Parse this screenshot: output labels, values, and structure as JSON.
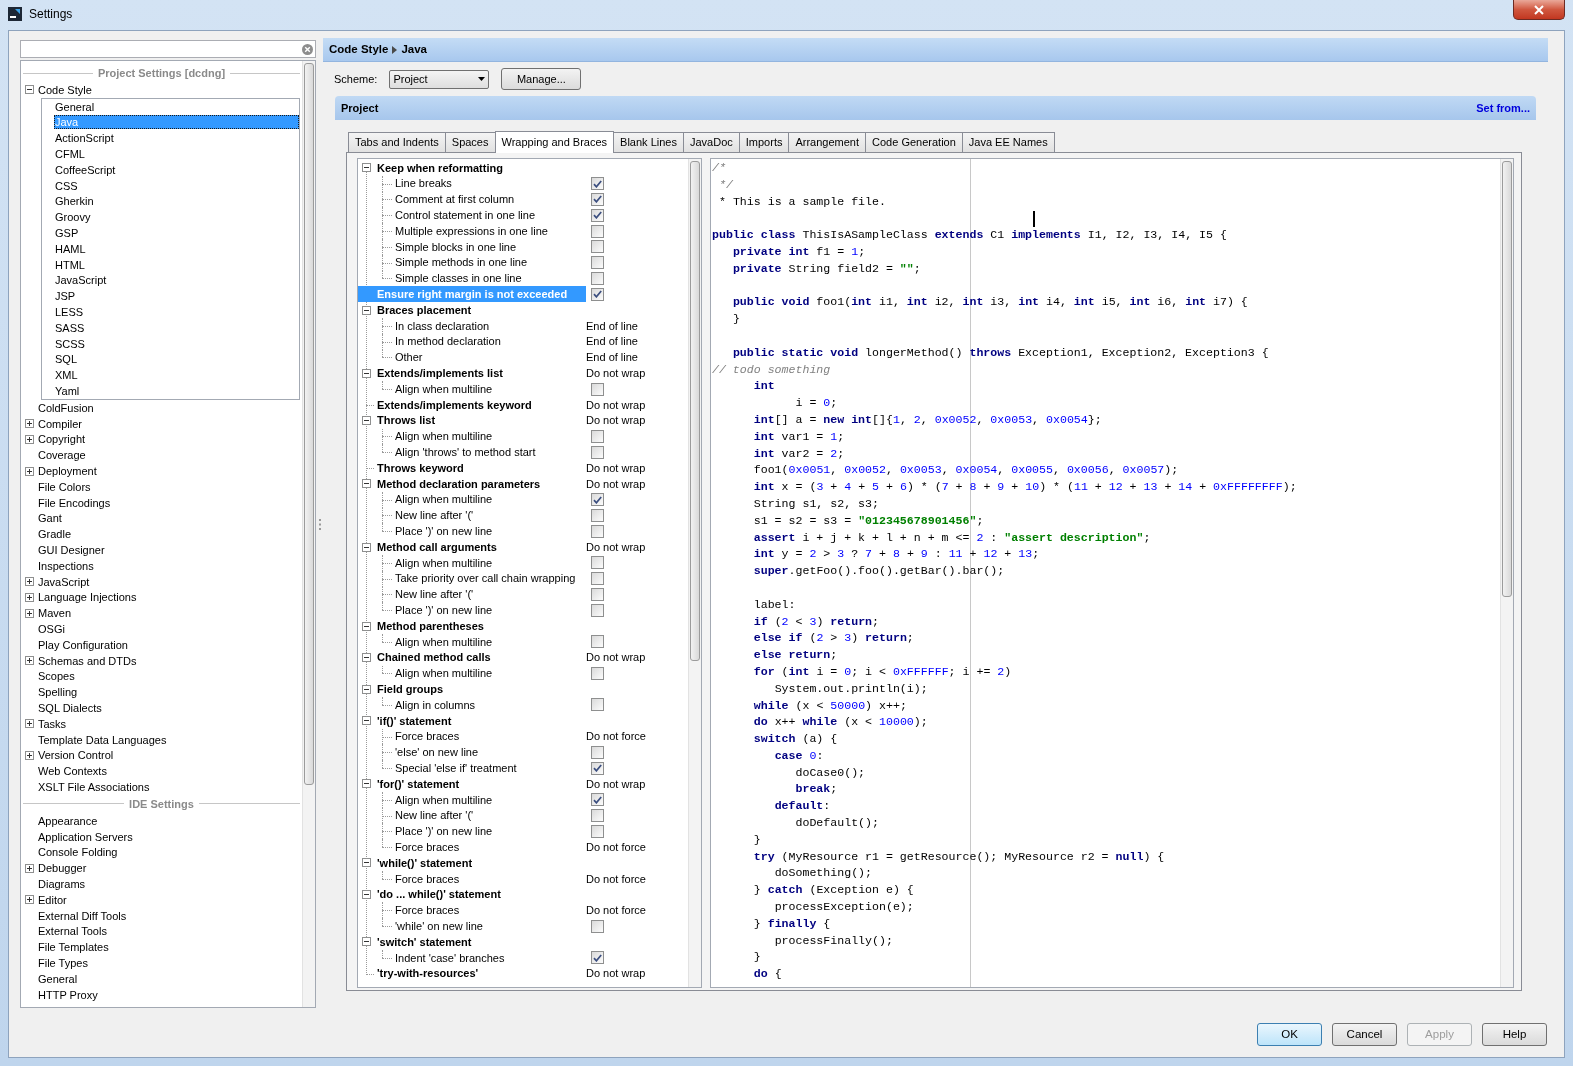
{
  "window": {
    "title": "Settings"
  },
  "sidebar": {
    "sections": [
      {
        "title": "Project Settings [dcdng]",
        "items": [
          {
            "label": "Code Style",
            "expanded": true,
            "selected": false,
            "children": [
              {
                "label": "General",
                "selected": false
              },
              {
                "label": "Java",
                "selected": true
              },
              {
                "label": "ActionScript",
                "selected": false
              },
              {
                "label": "CFML",
                "selected": false
              },
              {
                "label": "CoffeeScript",
                "selected": false
              },
              {
                "label": "CSS",
                "selected": false
              },
              {
                "label": "Gherkin",
                "selected": false
              },
              {
                "label": "Groovy",
                "selected": false
              },
              {
                "label": "GSP",
                "selected": false
              },
              {
                "label": "HAML",
                "selected": false
              },
              {
                "label": "HTML",
                "selected": false
              },
              {
                "label": "JavaScript",
                "selected": false
              },
              {
                "label": "JSP",
                "selected": false
              },
              {
                "label": "LESS",
                "selected": false
              },
              {
                "label": "SASS",
                "selected": false
              },
              {
                "label": "SCSS",
                "selected": false
              },
              {
                "label": "SQL",
                "selected": false
              },
              {
                "label": "XML",
                "selected": false
              },
              {
                "label": "Yaml",
                "selected": false
              }
            ]
          },
          {
            "label": "ColdFusion",
            "selected": false
          },
          {
            "label": "Compiler",
            "expanded": false,
            "selected": false
          },
          {
            "label": "Copyright",
            "expanded": false,
            "selected": false
          },
          {
            "label": "Coverage",
            "selected": false
          },
          {
            "label": "Deployment",
            "expanded": false,
            "selected": false
          },
          {
            "label": "File Colors",
            "selected": false
          },
          {
            "label": "File Encodings",
            "selected": false
          },
          {
            "label": "Gant",
            "selected": false
          },
          {
            "label": "Gradle",
            "selected": false
          },
          {
            "label": "GUI Designer",
            "selected": false
          },
          {
            "label": "Inspections",
            "selected": false
          },
          {
            "label": "JavaScript",
            "expanded": false,
            "selected": false
          },
          {
            "label": "Language Injections",
            "expanded": false,
            "selected": false
          },
          {
            "label": "Maven",
            "expanded": false,
            "selected": false
          },
          {
            "label": "OSGi",
            "selected": false
          },
          {
            "label": "Play Configuration",
            "selected": false
          },
          {
            "label": "Schemas and DTDs",
            "expanded": false,
            "selected": false
          },
          {
            "label": "Scopes",
            "selected": false
          },
          {
            "label": "Spelling",
            "selected": false
          },
          {
            "label": "SQL Dialects",
            "selected": false
          },
          {
            "label": "Tasks",
            "expanded": false,
            "selected": false
          },
          {
            "label": "Template Data Languages",
            "selected": false
          },
          {
            "label": "Version Control",
            "expanded": false,
            "selected": false
          },
          {
            "label": "Web Contexts",
            "selected": false
          },
          {
            "label": "XSLT File Associations",
            "selected": false
          }
        ]
      },
      {
        "title": "IDE Settings",
        "items": [
          {
            "label": "Appearance",
            "selected": false
          },
          {
            "label": "Application Servers",
            "selected": false
          },
          {
            "label": "Console Folding",
            "selected": false
          },
          {
            "label": "Debugger",
            "expanded": false,
            "selected": false
          },
          {
            "label": "Diagrams",
            "selected": false
          },
          {
            "label": "Editor",
            "expanded": false,
            "selected": false
          },
          {
            "label": "External Diff Tools",
            "selected": false
          },
          {
            "label": "External Tools",
            "selected": false
          },
          {
            "label": "File Templates",
            "selected": false
          },
          {
            "label": "File Types",
            "selected": false
          },
          {
            "label": "General",
            "selected": false
          },
          {
            "label": "HTTP Proxy",
            "selected": false
          }
        ]
      }
    ]
  },
  "breadcrumb": [
    "Code Style",
    "Java"
  ],
  "scheme": {
    "label": "Scheme:",
    "value": "Project",
    "button": "Manage..."
  },
  "section": {
    "title": "Project",
    "link": "Set from..."
  },
  "tabs": [
    {
      "label": "Tabs and Indents",
      "selected": false
    },
    {
      "label": "Spaces",
      "selected": false
    },
    {
      "label": "Wrapping and Braces",
      "selected": true
    },
    {
      "label": "Blank Lines",
      "selected": false
    },
    {
      "label": "JavaDoc",
      "selected": false
    },
    {
      "label": "Imports",
      "selected": false
    },
    {
      "label": "Arrangement",
      "selected": false
    },
    {
      "label": "Code Generation",
      "selected": false
    },
    {
      "label": "Java EE Names",
      "selected": false
    }
  ],
  "options": [
    {
      "label": "Keep when reformatting",
      "kind": "group",
      "expanded": true,
      "selected": false,
      "children": [
        {
          "label": "Line breaks",
          "kind": "checkbox",
          "checked": true,
          "selected": false
        },
        {
          "label": "Comment at first column",
          "kind": "checkbox",
          "checked": true,
          "selected": false
        },
        {
          "label": "Control statement in one line",
          "kind": "checkbox",
          "checked": true,
          "selected": false
        },
        {
          "label": "Multiple expressions in one line",
          "kind": "checkbox",
          "checked": false,
          "selected": false
        },
        {
          "label": "Simple blocks in one line",
          "kind": "checkbox",
          "checked": false,
          "selected": false
        },
        {
          "label": "Simple methods in one line",
          "kind": "checkbox",
          "checked": false,
          "selected": false
        },
        {
          "label": "Simple classes in one line",
          "kind": "checkbox",
          "checked": false,
          "selected": false
        }
      ]
    },
    {
      "label": "Ensure right margin is not exceeded",
      "kind": "checkbox",
      "checked": true,
      "selected": true
    },
    {
      "label": "Braces placement",
      "kind": "group",
      "expanded": true,
      "selected": false,
      "children": [
        {
          "label": "In class declaration",
          "kind": "value",
          "value": "End of line",
          "selected": false
        },
        {
          "label": "In method declaration",
          "kind": "value",
          "value": "End of line",
          "selected": false
        },
        {
          "label": "Other",
          "kind": "value",
          "value": "End of line",
          "selected": false
        }
      ]
    },
    {
      "label": "Extends/implements list",
      "kind": "group",
      "expanded": true,
      "value": "Do not wrap",
      "selected": false,
      "children": [
        {
          "label": "Align when multiline",
          "kind": "checkbox",
          "checked": false,
          "selected": false
        }
      ]
    },
    {
      "label": "Extends/implements keyword",
      "kind": "value",
      "value": "Do not wrap",
      "selected": false
    },
    {
      "label": "Throws list",
      "kind": "group",
      "expanded": true,
      "value": "Do not wrap",
      "selected": false,
      "children": [
        {
          "label": "Align when multiline",
          "kind": "checkbox",
          "checked": false,
          "selected": false
        },
        {
          "label": "Align 'throws' to method start",
          "kind": "checkbox",
          "checked": false,
          "selected": false
        }
      ]
    },
    {
      "label": "Throws keyword",
      "kind": "value",
      "value": "Do not wrap",
      "selected": false
    },
    {
      "label": "Method declaration parameters",
      "kind": "group",
      "expanded": true,
      "value": "Do not wrap",
      "selected": false,
      "children": [
        {
          "label": "Align when multiline",
          "kind": "checkbox",
          "checked": true,
          "selected": false
        },
        {
          "label": "New line after '('",
          "kind": "checkbox",
          "checked": false,
          "selected": false
        },
        {
          "label": "Place ')' on new line",
          "kind": "checkbox",
          "checked": false,
          "selected": false
        }
      ]
    },
    {
      "label": "Method call arguments",
      "kind": "group",
      "expanded": true,
      "value": "Do not wrap",
      "selected": false,
      "children": [
        {
          "label": "Align when multiline",
          "kind": "checkbox",
          "checked": false,
          "selected": false
        },
        {
          "label": "Take priority over call chain wrapping",
          "kind": "checkbox",
          "checked": false,
          "selected": false
        },
        {
          "label": "New line after '('",
          "kind": "checkbox",
          "checked": false,
          "selected": false
        },
        {
          "label": "Place ')' on new line",
          "kind": "checkbox",
          "checked": false,
          "selected": false
        }
      ]
    },
    {
      "label": "Method parentheses",
      "kind": "group",
      "expanded": true,
      "selected": false,
      "children": [
        {
          "label": "Align when multiline",
          "kind": "checkbox",
          "checked": false,
          "selected": false
        }
      ]
    },
    {
      "label": "Chained method calls",
      "kind": "group",
      "expanded": true,
      "value": "Do not wrap",
      "selected": false,
      "children": [
        {
          "label": "Align when multiline",
          "kind": "checkbox",
          "checked": false,
          "selected": false
        }
      ]
    },
    {
      "label": "Field groups",
      "kind": "group",
      "expanded": true,
      "selected": false,
      "children": [
        {
          "label": "Align in columns",
          "kind": "checkbox",
          "checked": false,
          "selected": false
        }
      ]
    },
    {
      "label": "'if()' statement",
      "kind": "group",
      "expanded": true,
      "selected": false,
      "children": [
        {
          "label": "Force braces",
          "kind": "value",
          "value": "Do not force",
          "selected": false
        },
        {
          "label": "'else' on new line",
          "kind": "checkbox",
          "checked": false,
          "selected": false
        },
        {
          "label": "Special 'else if' treatment",
          "kind": "checkbox",
          "checked": true,
          "selected": false
        }
      ]
    },
    {
      "label": "'for()' statement",
      "kind": "group",
      "expanded": true,
      "value": "Do not wrap",
      "selected": false,
      "children": [
        {
          "label": "Align when multiline",
          "kind": "checkbox",
          "checked": true,
          "selected": false
        },
        {
          "label": "New line after '('",
          "kind": "checkbox",
          "checked": false,
          "selected": false
        },
        {
          "label": "Place ')' on new line",
          "kind": "checkbox",
          "checked": false,
          "selected": false
        },
        {
          "label": "Force braces",
          "kind": "value",
          "value": "Do not force",
          "selected": false
        }
      ]
    },
    {
      "label": "'while()' statement",
      "kind": "group",
      "expanded": true,
      "selected": false,
      "children": [
        {
          "label": "Force braces",
          "kind": "value",
          "value": "Do not force",
          "selected": false
        }
      ]
    },
    {
      "label": "'do ... while()' statement",
      "kind": "group",
      "expanded": true,
      "selected": false,
      "children": [
        {
          "label": "Force braces",
          "kind": "value",
          "value": "Do not force",
          "selected": false
        },
        {
          "label": "'while' on new line",
          "kind": "checkbox",
          "checked": false,
          "selected": false
        }
      ]
    },
    {
      "label": "'switch' statement",
      "kind": "group",
      "expanded": true,
      "selected": false,
      "children": [
        {
          "label": "Indent 'case' branches",
          "kind": "checkbox",
          "checked": true,
          "selected": false
        }
      ]
    },
    {
      "label": "'try-with-resources'",
      "kind": "value",
      "value": "Do not wrap",
      "selected": false
    }
  ],
  "code_preview": {
    "blocks": [
      [
        [
          {
            "kind": "comment",
            "text": "/*"
          }
        ],
        [
          {
            "kind": "comment",
            "text": " */"
          }
        ],
        [
          {
            "kind": "plain",
            "text": " * This is a sample file."
          }
        ]
      ],
      [
        [
          {
            "kind": "keyword",
            "text": "public class"
          },
          {
            "kind": "plain",
            "text": " ThisIsASampleClass "
          },
          {
            "kind": "keyword",
            "text": "extends"
          },
          {
            "kind": "plain",
            "text": " C1 "
          },
          {
            "kind": "keyword",
            "text": "implements"
          },
          {
            "kind": "plain",
            "text": " I1, I2, I3, I4, I5 {"
          }
        ],
        [
          {
            "kind": "keyword",
            "text": "   private int"
          },
          {
            "kind": "plain",
            "text": " f1 = "
          },
          {
            "kind": "number",
            "text": "1"
          },
          {
            "kind": "plain",
            "text": ";"
          }
        ],
        [
          {
            "kind": "keyword",
            "text": "   private"
          },
          {
            "kind": "plain",
            "text": " String field2 = "
          },
          {
            "kind": "string",
            "text": "\"\""
          },
          {
            "kind": "plain",
            "text": ";"
          }
        ]
      ],
      [
        [
          {
            "kind": "keyword",
            "text": "   public void"
          },
          {
            "kind": "plain",
            "text": " foo1("
          },
          {
            "kind": "keyword",
            "text": "int"
          },
          {
            "kind": "plain",
            "text": " i1, "
          },
          {
            "kind": "keyword",
            "text": "int"
          },
          {
            "kind": "plain",
            "text": " i2, "
          },
          {
            "kind": "keyword",
            "text": "int"
          },
          {
            "kind": "plain",
            "text": " i3, "
          },
          {
            "kind": "keyword",
            "text": "int"
          },
          {
            "kind": "plain",
            "text": " i4, "
          },
          {
            "kind": "keyword",
            "text": "int"
          },
          {
            "kind": "plain",
            "text": " i5, "
          },
          {
            "kind": "keyword",
            "text": "int"
          },
          {
            "kind": "plain",
            "text": " i6, "
          },
          {
            "kind": "keyword",
            "text": "int"
          },
          {
            "kind": "plain",
            "text": " i7) {"
          }
        ],
        [
          {
            "kind": "plain",
            "text": "   }"
          }
        ]
      ],
      [
        [
          {
            "kind": "keyword",
            "text": "   public static void"
          },
          {
            "kind": "plain",
            "text": " longerMethod() "
          },
          {
            "kind": "keyword",
            "text": "throws"
          },
          {
            "kind": "plain",
            "text": " Exception1, Exception2, Exception3 {"
          }
        ],
        [
          {
            "kind": "comment",
            "text": "// todo something"
          }
        ],
        [
          {
            "kind": "keyword",
            "text": "      int"
          }
        ],
        [
          {
            "kind": "plain",
            "text": "            i = "
          },
          {
            "kind": "number",
            "text": "0"
          },
          {
            "kind": "plain",
            "text": ";"
          }
        ],
        [
          {
            "kind": "keyword",
            "text": "      int"
          },
          {
            "kind": "plain",
            "text": "[] a = "
          },
          {
            "kind": "keyword",
            "text": "new int"
          },
          {
            "kind": "plain",
            "text": "[]{"
          },
          {
            "kind": "number",
            "text": "1"
          },
          {
            "kind": "plain",
            "text": ", "
          },
          {
            "kind": "number",
            "text": "2"
          },
          {
            "kind": "plain",
            "text": ", "
          },
          {
            "kind": "number",
            "text": "0x0052"
          },
          {
            "kind": "plain",
            "text": ", "
          },
          {
            "kind": "number",
            "text": "0x0053"
          },
          {
            "kind": "plain",
            "text": ", "
          },
          {
            "kind": "number",
            "text": "0x0054"
          },
          {
            "kind": "plain",
            "text": "};"
          }
        ],
        [
          {
            "kind": "keyword",
            "text": "      int"
          },
          {
            "kind": "plain",
            "text": " var1 = "
          },
          {
            "kind": "number",
            "text": "1"
          },
          {
            "kind": "plain",
            "text": ";"
          }
        ],
        [
          {
            "kind": "keyword",
            "text": "      int"
          },
          {
            "kind": "plain",
            "text": " var2 = "
          },
          {
            "kind": "number",
            "text": "2"
          },
          {
            "kind": "plain",
            "text": ";"
          }
        ],
        [
          {
            "kind": "plain",
            "text": "      foo1("
          },
          {
            "kind": "number",
            "text": "0x0051"
          },
          {
            "kind": "plain",
            "text": ", "
          },
          {
            "kind": "number",
            "text": "0x0052"
          },
          {
            "kind": "plain",
            "text": ", "
          },
          {
            "kind": "number",
            "text": "0x0053"
          },
          {
            "kind": "plain",
            "text": ", "
          },
          {
            "kind": "number",
            "text": "0x0054"
          },
          {
            "kind": "plain",
            "text": ", "
          },
          {
            "kind": "number",
            "text": "0x0055"
          },
          {
            "kind": "plain",
            "text": ", "
          },
          {
            "kind": "number",
            "text": "0x0056"
          },
          {
            "kind": "plain",
            "text": ", "
          },
          {
            "kind": "number",
            "text": "0x0057"
          },
          {
            "kind": "plain",
            "text": ");"
          }
        ],
        [
          {
            "kind": "keyword",
            "text": "      int"
          },
          {
            "kind": "plain",
            "text": " x = ("
          },
          {
            "kind": "number",
            "text": "3"
          },
          {
            "kind": "plain",
            "text": " + "
          },
          {
            "kind": "number",
            "text": "4"
          },
          {
            "kind": "plain",
            "text": " + "
          },
          {
            "kind": "number",
            "text": "5"
          },
          {
            "kind": "plain",
            "text": " + "
          },
          {
            "kind": "number",
            "text": "6"
          },
          {
            "kind": "plain",
            "text": ") * ("
          },
          {
            "kind": "number",
            "text": "7"
          },
          {
            "kind": "plain",
            "text": " + "
          },
          {
            "kind": "number",
            "text": "8"
          },
          {
            "kind": "plain",
            "text": " + "
          },
          {
            "kind": "number",
            "text": "9"
          },
          {
            "kind": "plain",
            "text": " + "
          },
          {
            "kind": "number",
            "text": "10"
          },
          {
            "kind": "plain",
            "text": ") * ("
          },
          {
            "kind": "number",
            "text": "11"
          },
          {
            "kind": "plain",
            "text": " + "
          },
          {
            "kind": "number",
            "text": "12"
          },
          {
            "kind": "plain",
            "text": " + "
          },
          {
            "kind": "number",
            "text": "13"
          },
          {
            "kind": "plain",
            "text": " + "
          },
          {
            "kind": "number",
            "text": "14"
          },
          {
            "kind": "plain",
            "text": " + "
          },
          {
            "kind": "number",
            "text": "0xFFFFFFFF"
          },
          {
            "kind": "plain",
            "text": ");"
          }
        ],
        [
          {
            "kind": "plain",
            "text": "      String s1, s2, s3;"
          }
        ],
        [
          {
            "kind": "plain",
            "text": "      s1 = s2 = s3 = "
          },
          {
            "kind": "string",
            "text": "\"012345678901456\""
          },
          {
            "kind": "plain",
            "text": ";"
          }
        ],
        [
          {
            "kind": "keyword",
            "text": "      assert"
          },
          {
            "kind": "plain",
            "text": " i + j + k + l + n + m <= "
          },
          {
            "kind": "number",
            "text": "2"
          },
          {
            "kind": "plain",
            "text": " : "
          },
          {
            "kind": "string",
            "text": "\"assert description\""
          },
          {
            "kind": "plain",
            "text": ";"
          }
        ],
        [
          {
            "kind": "keyword",
            "text": "      int"
          },
          {
            "kind": "plain",
            "text": " y = "
          },
          {
            "kind": "number",
            "text": "2"
          },
          {
            "kind": "plain",
            "text": " > "
          },
          {
            "kind": "number",
            "text": "3"
          },
          {
            "kind": "plain",
            "text": " ? "
          },
          {
            "kind": "number",
            "text": "7"
          },
          {
            "kind": "plain",
            "text": " + "
          },
          {
            "kind": "number",
            "text": "8"
          },
          {
            "kind": "plain",
            "text": " + "
          },
          {
            "kind": "number",
            "text": "9"
          },
          {
            "kind": "plain",
            "text": " : "
          },
          {
            "kind": "number",
            "text": "11"
          },
          {
            "kind": "plain",
            "text": " + "
          },
          {
            "kind": "number",
            "text": "12"
          },
          {
            "kind": "plain",
            "text": " + "
          },
          {
            "kind": "number",
            "text": "13"
          },
          {
            "kind": "plain",
            "text": ";"
          }
        ],
        [
          {
            "kind": "keyword",
            "text": "      super"
          },
          {
            "kind": "plain",
            "text": ".getFoo().foo().getBar().bar();"
          }
        ]
      ],
      [
        [
          {
            "kind": "plain",
            "text": "      label:"
          }
        ],
        [
          {
            "kind": "keyword",
            "text": "      if"
          },
          {
            "kind": "plain",
            "text": " ("
          },
          {
            "kind": "number",
            "text": "2"
          },
          {
            "kind": "plain",
            "text": " < "
          },
          {
            "kind": "number",
            "text": "3"
          },
          {
            "kind": "plain",
            "text": ") "
          },
          {
            "kind": "keyword",
            "text": "return"
          },
          {
            "kind": "plain",
            "text": ";"
          }
        ],
        [
          {
            "kind": "keyword",
            "text": "      else if"
          },
          {
            "kind": "plain",
            "text": " ("
          },
          {
            "kind": "number",
            "text": "2"
          },
          {
            "kind": "plain",
            "text": " > "
          },
          {
            "kind": "number",
            "text": "3"
          },
          {
            "kind": "plain",
            "text": ") "
          },
          {
            "kind": "keyword",
            "text": "return"
          },
          {
            "kind": "plain",
            "text": ";"
          }
        ],
        [
          {
            "kind": "keyword",
            "text": "      else return"
          },
          {
            "kind": "plain",
            "text": ";"
          }
        ],
        [
          {
            "kind": "keyword",
            "text": "      for"
          },
          {
            "kind": "plain",
            "text": " ("
          },
          {
            "kind": "keyword",
            "text": "int"
          },
          {
            "kind": "plain",
            "text": " i = "
          },
          {
            "kind": "number",
            "text": "0"
          },
          {
            "kind": "plain",
            "text": "; i < "
          },
          {
            "kind": "number",
            "text": "0xFFFFFF"
          },
          {
            "kind": "plain",
            "text": "; i += "
          },
          {
            "kind": "number",
            "text": "2"
          },
          {
            "kind": "plain",
            "text": ")"
          }
        ],
        [
          {
            "kind": "plain",
            "text": "         System.out.println(i);"
          }
        ],
        [
          {
            "kind": "keyword",
            "text": "      while"
          },
          {
            "kind": "plain",
            "text": " (x < "
          },
          {
            "kind": "number",
            "text": "50000"
          },
          {
            "kind": "plain",
            "text": ") x++;"
          }
        ],
        [
          {
            "kind": "keyword",
            "text": "      do"
          },
          {
            "kind": "plain",
            "text": " x++ "
          },
          {
            "kind": "keyword",
            "text": "while"
          },
          {
            "kind": "plain",
            "text": " (x < "
          },
          {
            "kind": "number",
            "text": "10000"
          },
          {
            "kind": "plain",
            "text": ");"
          }
        ],
        [
          {
            "kind": "keyword",
            "text": "      switch"
          },
          {
            "kind": "plain",
            "text": " (a) {"
          }
        ],
        [
          {
            "kind": "keyword",
            "text": "         case "
          },
          {
            "kind": "number",
            "text": "0"
          },
          {
            "kind": "plain",
            "text": ":"
          }
        ],
        [
          {
            "kind": "plain",
            "text": "            doCase0();"
          }
        ],
        [
          {
            "kind": "keyword",
            "text": "            break"
          },
          {
            "kind": "plain",
            "text": ";"
          }
        ],
        [
          {
            "kind": "keyword",
            "text": "         default"
          },
          {
            "kind": "plain",
            "text": ":"
          }
        ],
        [
          {
            "kind": "plain",
            "text": "            doDefault();"
          }
        ],
        [
          {
            "kind": "plain",
            "text": "      }"
          }
        ],
        [
          {
            "kind": "keyword",
            "text": "      try"
          },
          {
            "kind": "plain",
            "text": " (MyResource r1 = getResource(); MyResource r2 = "
          },
          {
            "kind": "keyword",
            "text": "null"
          },
          {
            "kind": "plain",
            "text": ") {"
          }
        ],
        [
          {
            "kind": "plain",
            "text": "         doSomething();"
          }
        ],
        [
          {
            "kind": "plain",
            "text": "      } "
          },
          {
            "kind": "keyword",
            "text": "catch"
          },
          {
            "kind": "plain",
            "text": " (Exception e) {"
          }
        ],
        [
          {
            "kind": "plain",
            "text": "         processException(e);"
          }
        ],
        [
          {
            "kind": "plain",
            "text": "      } "
          },
          {
            "kind": "keyword",
            "text": "finally"
          },
          {
            "kind": "plain",
            "text": " {"
          }
        ],
        [
          {
            "kind": "plain",
            "text": "         processFinally();"
          }
        ],
        [
          {
            "kind": "plain",
            "text": "      }"
          }
        ],
        [
          {
            "kind": "keyword",
            "text": "      do"
          },
          {
            "kind": "plain",
            "text": " {"
          }
        ]
      ]
    ]
  },
  "buttons": [
    {
      "label": "OK",
      "default": true,
      "disabled": false
    },
    {
      "label": "Cancel",
      "default": false,
      "disabled": false
    },
    {
      "label": "Apply",
      "default": false,
      "disabled": true
    },
    {
      "label": "Help",
      "default": false,
      "disabled": false
    }
  ]
}
